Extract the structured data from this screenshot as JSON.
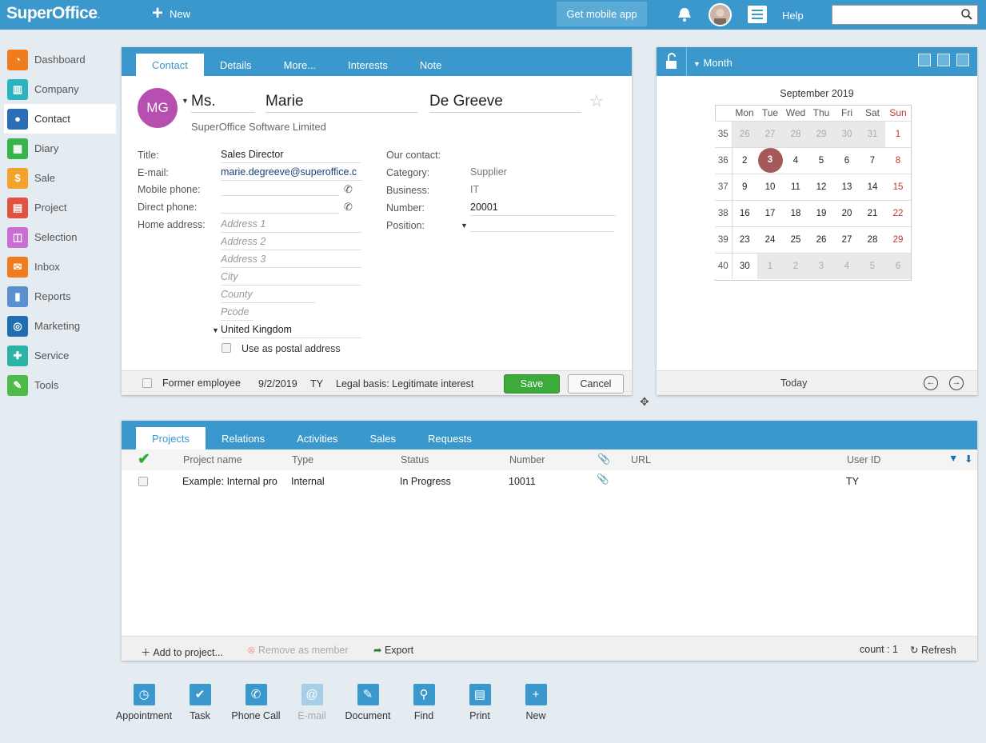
{
  "topbar": {
    "logo": "SuperOffice",
    "logo_dot": ".",
    "new_label": "New",
    "mobile_label": "Get mobile app",
    "help_label": "Help",
    "search_value": ""
  },
  "sidebar": {
    "items": [
      {
        "label": "Dashboard",
        "color": "#f07c1e",
        "glyph": "◔"
      },
      {
        "label": "Company",
        "color": "#2cb3c0",
        "glyph": "▥"
      },
      {
        "label": "Contact",
        "color": "#2a6fb5",
        "glyph": "●"
      },
      {
        "label": "Diary",
        "color": "#37b44a",
        "glyph": "▦"
      },
      {
        "label": "Sale",
        "color": "#f3a32c",
        "glyph": "$"
      },
      {
        "label": "Project",
        "color": "#e2523f",
        "glyph": "▤"
      },
      {
        "label": "Selection",
        "color": "#c86fd1",
        "glyph": "◫"
      },
      {
        "label": "Inbox",
        "color": "#f07c1e",
        "glyph": "✉"
      },
      {
        "label": "Reports",
        "color": "#5a8fd0",
        "glyph": "▮"
      },
      {
        "label": "Marketing",
        "color": "#1f6fb0",
        "glyph": "◎"
      },
      {
        "label": "Service",
        "color": "#2bb3a6",
        "glyph": "✚"
      },
      {
        "label": "Tools",
        "color": "#4dbb47",
        "glyph": "✎"
      }
    ]
  },
  "contact": {
    "tabs": [
      "Contact",
      "Details",
      "More...",
      "Interests",
      "Note"
    ],
    "initials": "MG",
    "salutation": "Ms.",
    "first_name": "Marie",
    "last_name": "De Greeve",
    "company": "SuperOffice Software Limited",
    "labels": {
      "title": "Title:",
      "email": "E-mail:",
      "mobile": "Mobile phone:",
      "direct": "Direct phone:",
      "home": "Home address:",
      "our_contact": "Our contact:",
      "category": "Category:",
      "business": "Business:",
      "number": "Number:",
      "position": "Position:"
    },
    "values": {
      "title": "Sales Director",
      "email": "marie.degreeve@superoffice.c",
      "mobile": "",
      "direct": "",
      "our_contact": "",
      "category": "Supplier",
      "business": "IT",
      "number": "20001",
      "position": ""
    },
    "address_placeholders": {
      "address1": "Address 1",
      "address2": "Address 2",
      "address3": "Address 3",
      "city": "City",
      "county": "County",
      "pcode": "Pcode"
    },
    "country": "United Kingdom",
    "postal_label": "Use as postal address",
    "footer": {
      "former_label": "Former employee",
      "date": "9/2/2019",
      "user": "TY",
      "legal": "Legal basis: Legitimate interest",
      "save": "Save",
      "cancel": "Cancel"
    }
  },
  "calendar": {
    "mode": "Month",
    "title": "September 2019",
    "days": [
      "Mon",
      "Tue",
      "Wed",
      "Thu",
      "Fri",
      "Sat",
      "Sun"
    ],
    "weeks": [
      {
        "wk": "35",
        "days": [
          "26",
          "27",
          "28",
          "29",
          "30",
          "31",
          "1"
        ]
      },
      {
        "wk": "36",
        "days": [
          "2",
          "3",
          "4",
          "5",
          "6",
          "7",
          "8"
        ]
      },
      {
        "wk": "37",
        "days": [
          "9",
          "10",
          "11",
          "12",
          "13",
          "14",
          "15"
        ]
      },
      {
        "wk": "38",
        "days": [
          "16",
          "17",
          "18",
          "19",
          "20",
          "21",
          "22"
        ]
      },
      {
        "wk": "39",
        "days": [
          "23",
          "24",
          "25",
          "26",
          "27",
          "28",
          "29"
        ]
      },
      {
        "wk": "40",
        "days": [
          "30",
          "1",
          "2",
          "3",
          "4",
          "5",
          "6"
        ]
      }
    ],
    "today_day": "3",
    "today_label": "Today"
  },
  "projects": {
    "tabs": [
      "Projects",
      "Relations",
      "Activities",
      "Sales",
      "Requests"
    ],
    "columns": [
      "Project name",
      "Type",
      "Status",
      "Number",
      "URL",
      "User ID"
    ],
    "rows": [
      {
        "name": "Example: Internal pro",
        "type": "Internal",
        "status": "In Progress",
        "number": "10011",
        "url": "",
        "user": "TY"
      }
    ],
    "footer": {
      "add": "Add to project...",
      "remove": "Remove as member",
      "export": "Export",
      "count": "count : 1",
      "refresh": "Refresh"
    }
  },
  "bottom_actions": [
    "Appointment",
    "Task",
    "Phone Call",
    "E-mail",
    "Document",
    "Find",
    "Print",
    "New"
  ]
}
